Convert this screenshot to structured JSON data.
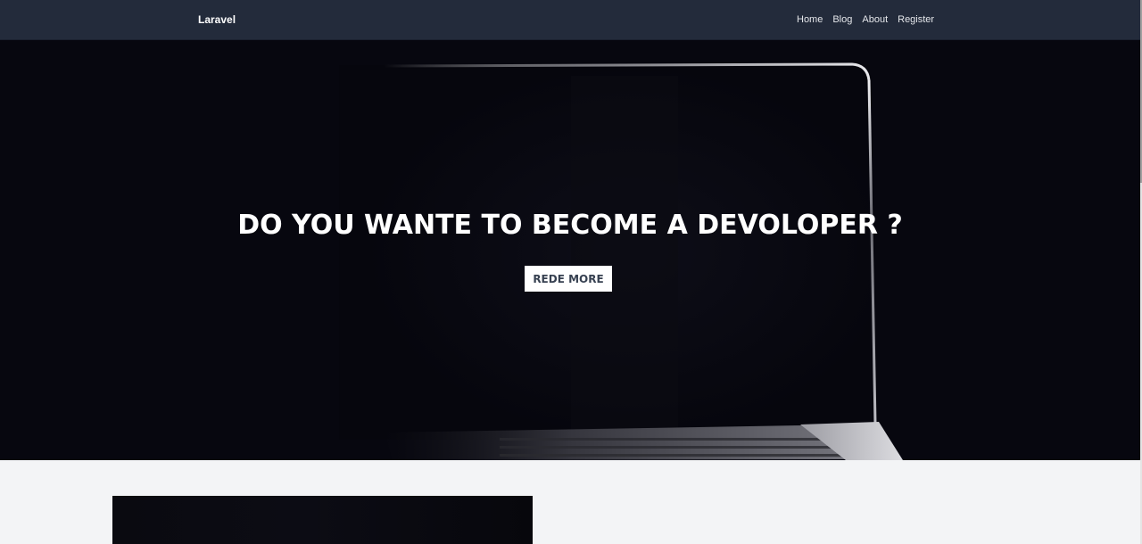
{
  "navbar": {
    "brand": "Laravel",
    "links": [
      {
        "label": "Home"
      },
      {
        "label": "Blog"
      },
      {
        "label": "About"
      },
      {
        "label": "Register"
      }
    ]
  },
  "hero": {
    "title": "DO YOU WANTE TO BECOME A DEVOLOPER ?",
    "button_label": "REDE MORE"
  },
  "colors": {
    "navbar_bg": "#232b3b",
    "hero_bg": "#07070f",
    "page_bg": "#f3f4f6",
    "button_bg": "#ffffff",
    "button_text": "#374151"
  }
}
